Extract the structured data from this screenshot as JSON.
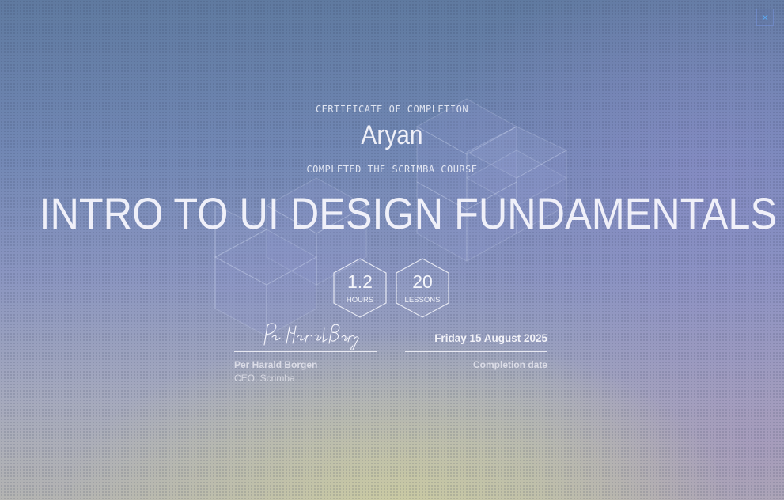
{
  "close_button": {
    "label": "×",
    "icon": "close-icon"
  },
  "certificate": {
    "heading": "CERTIFICATE OF COMPLETION",
    "recipient_name": "Aryan",
    "subheading": "COMPLETED THE SCRIMBA COURSE",
    "course_title": "INTRO TO UI DESIGN FUNDAMENTALS",
    "stats": [
      {
        "value": "1.2",
        "unit": "HOURS"
      },
      {
        "value": "20",
        "unit": "LESSONS"
      }
    ],
    "signer": {
      "name": "Per Harald Borgen",
      "title": "CEO, Scrimba",
      "signature_icon": "handwritten-signature"
    },
    "completion": {
      "date": "Friday 15 August 2025",
      "label": "Completion date"
    }
  },
  "colors": {
    "background_top": "#5f7aa0",
    "background_mid": "#8a95c0",
    "background_bottom_glow": "#cecea0",
    "text": "#f5f6fb",
    "close_icon": "#5aa7f0"
  }
}
